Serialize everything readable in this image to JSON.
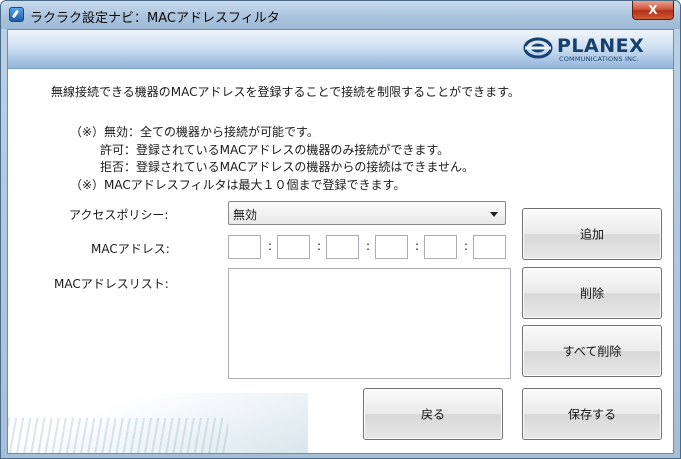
{
  "window": {
    "title": "ラクラク設定ナビ：MACアドレスフィルタ",
    "close_label": "X"
  },
  "logo": {
    "name": "PLANEX",
    "sub": "COMMUNICATIONS INC."
  },
  "intro": "無線接続できる機器のMACアドレスを登録することで接続を制限することができます。",
  "notes": [
    "（※）無効：全ての機器から接続が可能です。",
    "許可：登録されているMACアドレスの機器のみ接続ができます。",
    "拒否：登録されているMACアドレスの機器からの接続はできません。",
    "（※）MACアドレスフィルタは最大１０個まで登録できます。"
  ],
  "form": {
    "policy_label": "アクセスポリシー:",
    "policy_value": "無効",
    "mac_label": "MACアドレス:",
    "mac_octets": [
      "",
      "",
      "",
      "",
      "",
      ""
    ],
    "mac_separator": ":",
    "list_label": "MACアドレスリスト:",
    "list_items": []
  },
  "buttons": {
    "add": "追加",
    "delete": "削除",
    "delete_all": "すべて削除",
    "back": "戻る",
    "save": "保存する"
  }
}
